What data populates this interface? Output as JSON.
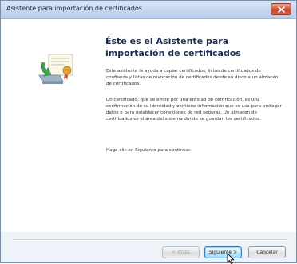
{
  "window": {
    "title": "Asistente para importación de certificados"
  },
  "wizard": {
    "heading": "Éste es el Asistente para importación de certificados",
    "paragraph1": "Este asistente le ayuda a copiar certificados, listas de certificados de confianza y listas de revocación de certificados desde su disco a un almacén de certificados.",
    "paragraph2": "Un certificado, que se emite por una entidad de certificación, es una confirmación de su identidad y contiene información que se usa para proteger datos o para establecer conexiones de red seguras. Un almacén de certificados es el área del sistema donde se guardan los certificados.",
    "paragraph3": "Haga clic en Siguiente para continuar."
  },
  "buttons": {
    "back": "< Atrás",
    "next": "Siguiente >",
    "cancel": "Cancelar"
  },
  "colors": {
    "title_bar": "#c3d6ef",
    "close_button": "#c9492f",
    "heading_text": "#1d2c4c",
    "next_button_border": "#3c7fb1"
  },
  "icons": {
    "wizard_art": "certificate-computer-icon",
    "close": "close-icon",
    "cursor": "mouse-pointer-icon"
  }
}
